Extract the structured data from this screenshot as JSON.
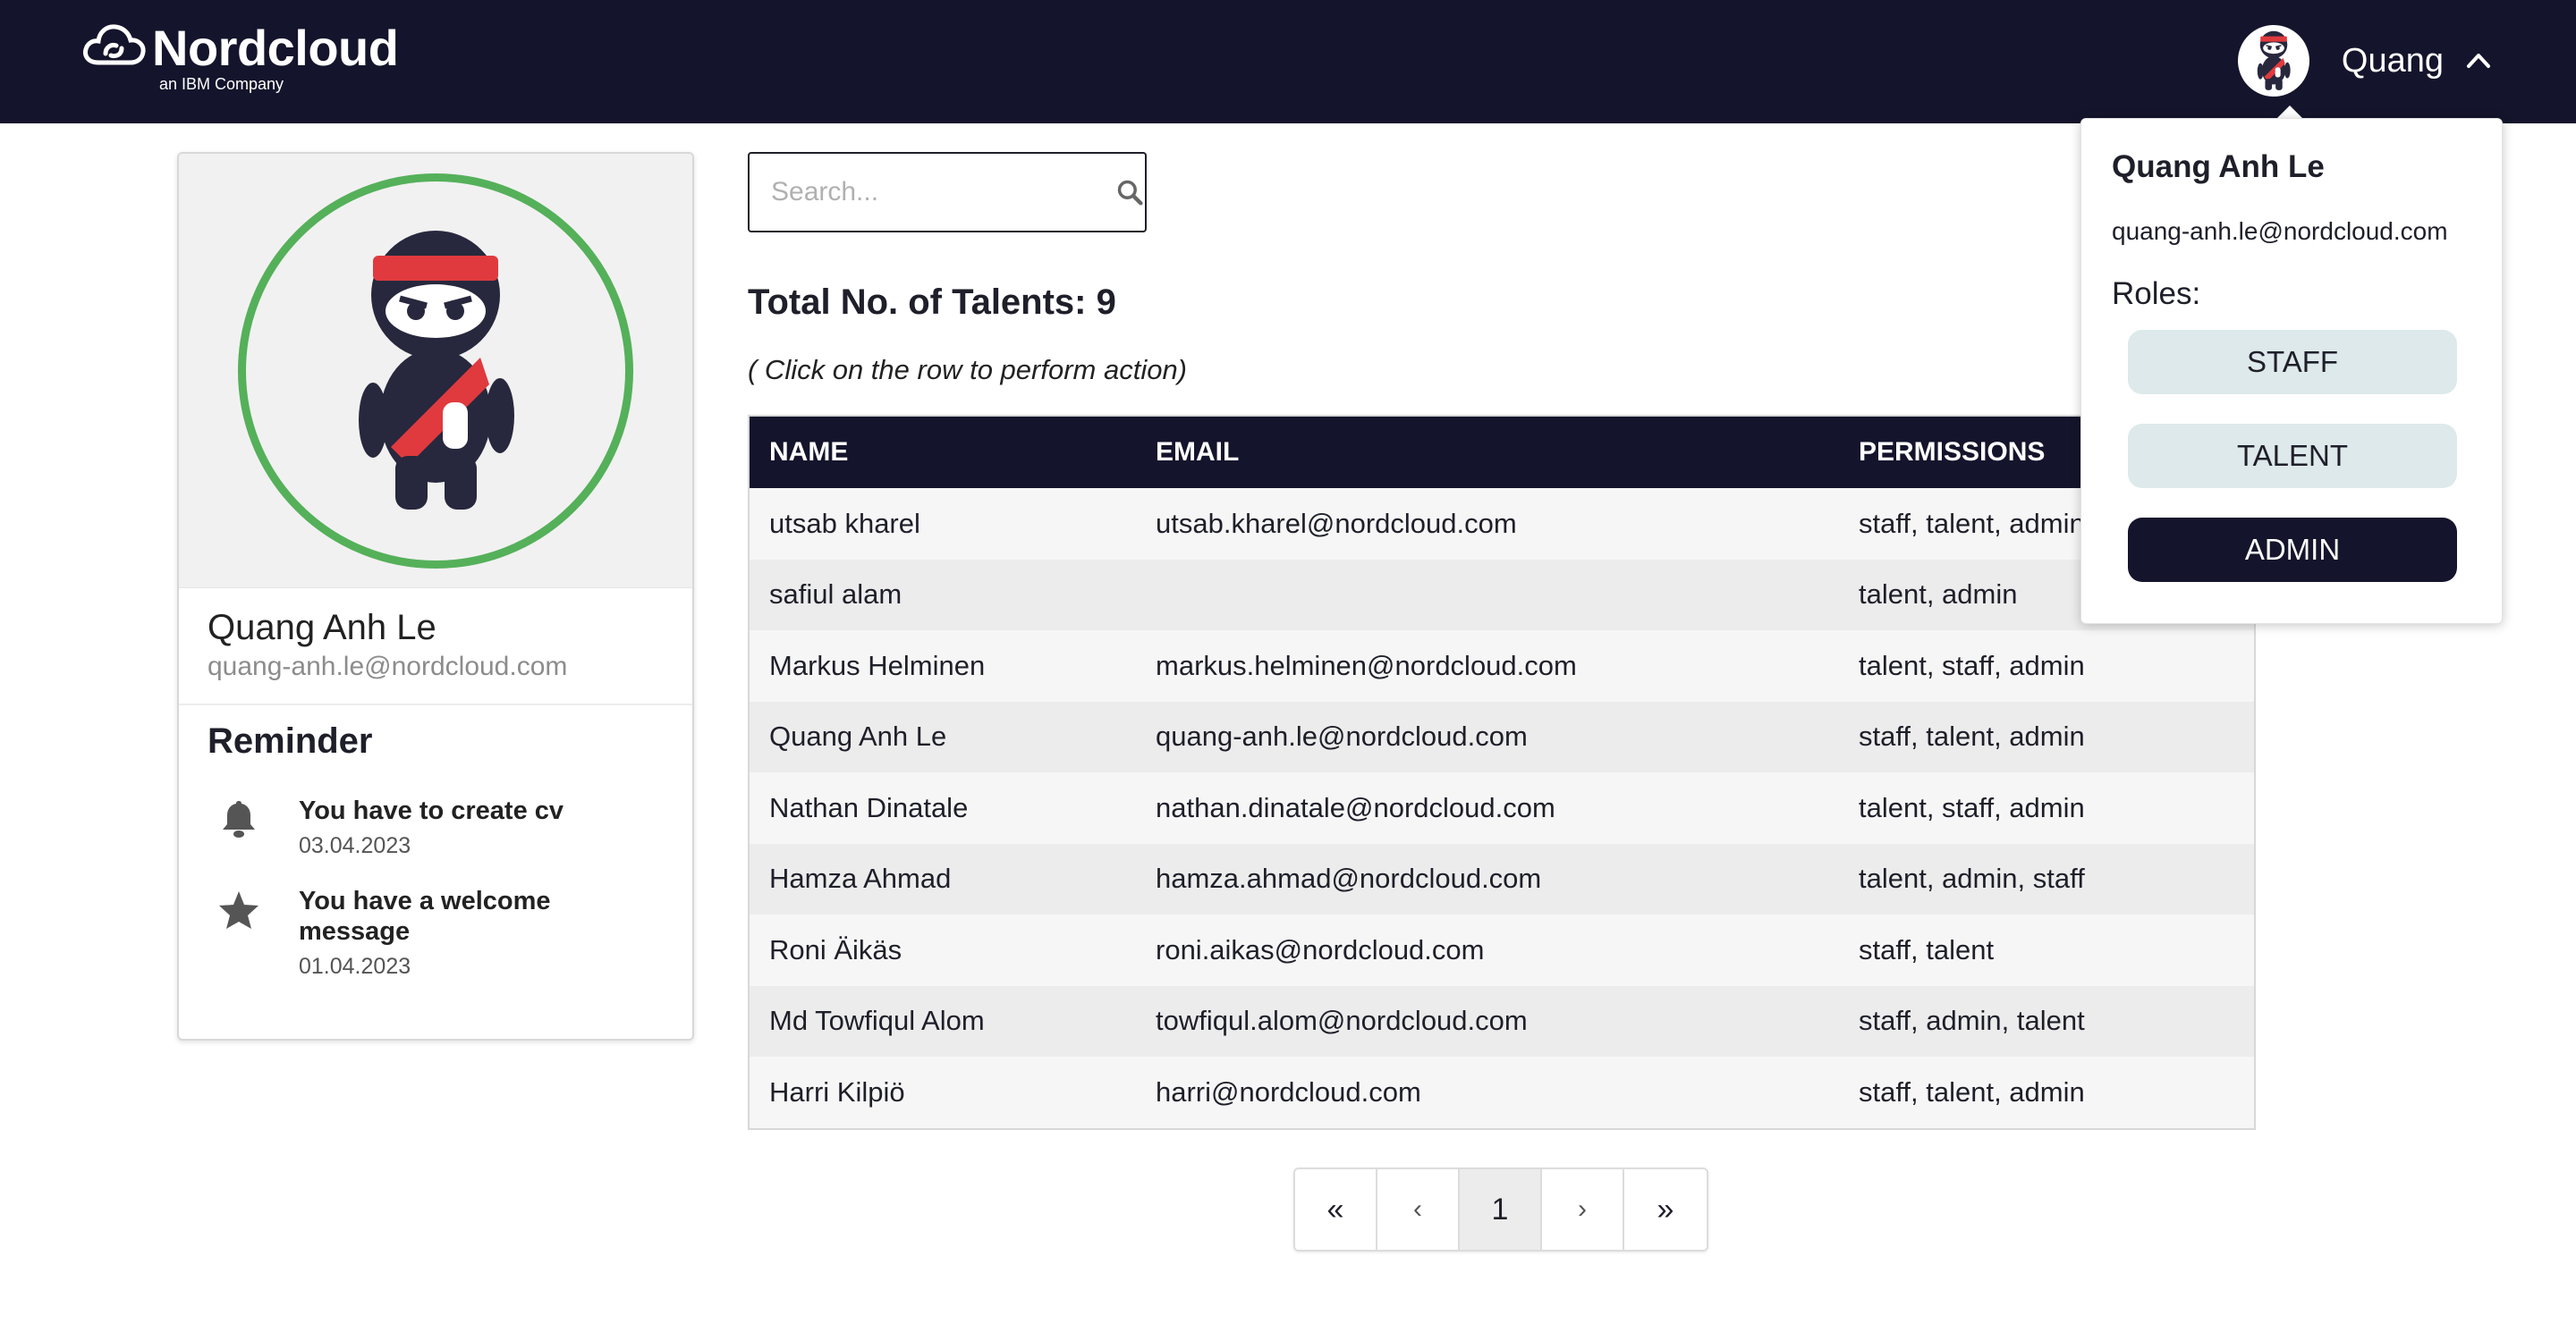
{
  "header": {
    "logo_text": "Nordcloud",
    "logo_sub": "an IBM Company",
    "user_name": "Quang",
    "brand_color": "#14142c"
  },
  "profile": {
    "name": "Quang Anh Le",
    "email": "quang-anh.le@nordcloud.com",
    "avatar_ring_color": "#55b05a",
    "reminder_title": "Reminder",
    "reminders": [
      {
        "icon": "bell-icon",
        "text": "You have to create cv",
        "date": "03.04.2023"
      },
      {
        "icon": "star-icon",
        "text": "You have a welcome message",
        "date": "01.04.2023"
      }
    ]
  },
  "search": {
    "placeholder": "Search...",
    "value": ""
  },
  "talents": {
    "total_label": "Total No. of Talents: 9",
    "hint": "( Click on the row to perform action)",
    "columns": [
      "NAME",
      "EMAIL",
      "PERMISSIONS"
    ],
    "rows": [
      {
        "name": "utsab kharel",
        "email": "utsab.kharel@nordcloud.com",
        "permissions": "staff, talent, admin"
      },
      {
        "name": "safiul alam",
        "email": "",
        "permissions": "talent, admin"
      },
      {
        "name": "Markus Helminen",
        "email": "markus.helminen@nordcloud.com",
        "permissions": "talent, staff, admin"
      },
      {
        "name": "Quang Anh Le",
        "email": "quang-anh.le@nordcloud.com",
        "permissions": "staff, talent, admin"
      },
      {
        "name": "Nathan Dinatale",
        "email": "nathan.dinatale@nordcloud.com",
        "permissions": "talent, staff, admin"
      },
      {
        "name": "Hamza Ahmad",
        "email": "hamza.ahmad@nordcloud.com",
        "permissions": "talent, admin, staff"
      },
      {
        "name": "Roni Äikäs",
        "email": "roni.aikas@nordcloud.com",
        "permissions": "staff, talent"
      },
      {
        "name": "Md Towfiqul Alom",
        "email": "towfiqul.alom@nordcloud.com",
        "permissions": "staff, admin, talent"
      },
      {
        "name": "Harri Kilpiö",
        "email": "harri@nordcloud.com",
        "permissions": "staff, talent, admin"
      }
    ]
  },
  "pagination": {
    "first": "«",
    "prev": "‹",
    "current": "1",
    "next": "›",
    "last": "»"
  },
  "dropdown": {
    "name": "Quang Anh Le",
    "email": "quang-anh.le@nordcloud.com",
    "roles_label": "Roles:",
    "roles": [
      "STAFF",
      "TALENT",
      "ADMIN"
    ],
    "active_role": "ADMIN"
  }
}
